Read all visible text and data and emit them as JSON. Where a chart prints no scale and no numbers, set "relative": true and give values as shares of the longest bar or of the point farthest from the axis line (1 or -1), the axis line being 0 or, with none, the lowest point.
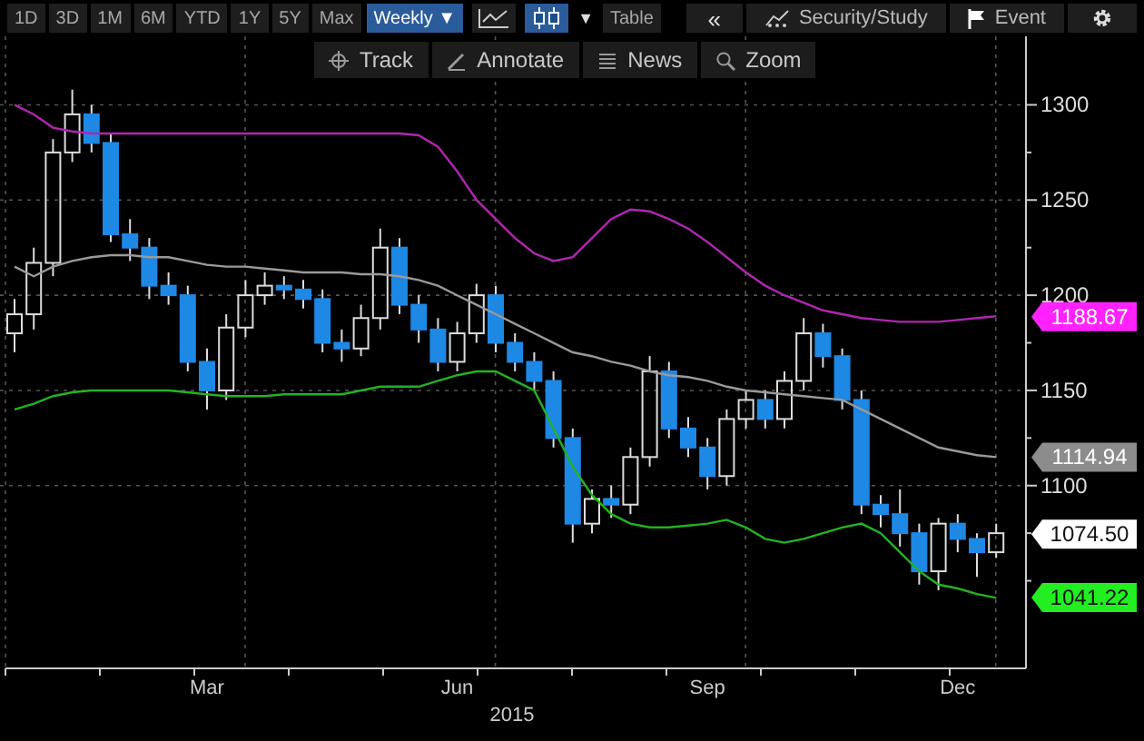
{
  "toolbar": {
    "range_buttons": [
      {
        "label": "1D",
        "selected": false
      },
      {
        "label": "3D",
        "selected": false
      },
      {
        "label": "1M",
        "selected": false
      },
      {
        "label": "6M",
        "selected": false
      },
      {
        "label": "YTD",
        "selected": false
      },
      {
        "label": "1Y",
        "selected": false
      },
      {
        "label": "5Y",
        "selected": false
      },
      {
        "label": "Max",
        "selected": false
      }
    ],
    "period_dropdown": {
      "label": "Weekly",
      "caret": "▼"
    },
    "chart_type_buttons": [
      {
        "kind": "line",
        "selected": false
      },
      {
        "kind": "candle",
        "selected": true
      }
    ],
    "chart_type_caret": "▼",
    "table_button": "Table",
    "collapse_button": "«",
    "security_study_button": "Security/Study",
    "event_button": "Event"
  },
  "chart_tools": [
    {
      "kind": "track",
      "label": "Track"
    },
    {
      "kind": "annotate",
      "label": "Annotate"
    },
    {
      "kind": "news",
      "label": "News"
    },
    {
      "kind": "zoom",
      "label": "Zoom"
    }
  ],
  "price_tags": [
    {
      "label": "1188.67",
      "color": "#ff22ff"
    },
    {
      "label": "1114.94",
      "color": "#8c8c8c"
    },
    {
      "label": "1074.50",
      "color": "#ffffff"
    },
    {
      "label": "1041.22",
      "color": "#22ee22"
    }
  ],
  "price_chart": {
    "chart_data": {
      "type": "candlestick",
      "categories": [
        null,
        null,
        null,
        null,
        null,
        null,
        null,
        null,
        null,
        null,
        "Mar",
        null,
        null,
        null,
        null,
        null,
        null,
        null,
        null,
        null,
        null,
        null,
        null,
        "Jun",
        null,
        null,
        null,
        null,
        null,
        null,
        null,
        null,
        null,
        null,
        null,
        null,
        "Sep",
        null,
        null,
        null,
        null,
        null,
        null,
        null,
        null,
        null,
        null,
        null,
        null,
        "Dec",
        null,
        null
      ],
      "xlabel": "2015",
      "grid": true,
      "ylim": [
        1004,
        1336
      ],
      "yticks": [
        1100,
        1150,
        1200,
        1250,
        1300
      ],
      "ohlc": [
        [
          1180,
          1198,
          1170,
          1190
        ],
        [
          1190,
          1225,
          1182,
          1217
        ],
        [
          1217,
          1282,
          1210,
          1275
        ],
        [
          1275,
          1308,
          1270,
          1295
        ],
        [
          1295,
          1300,
          1275,
          1280
        ],
        [
          1280,
          1285,
          1228,
          1232
        ],
        [
          1232,
          1240,
          1218,
          1225
        ],
        [
          1225,
          1230,
          1198,
          1205
        ],
        [
          1205,
          1212,
          1195,
          1200
        ],
        [
          1200,
          1205,
          1160,
          1165
        ],
        [
          1165,
          1172,
          1140,
          1150
        ],
        [
          1150,
          1190,
          1145,
          1183
        ],
        [
          1183,
          1208,
          1178,
          1200
        ],
        [
          1200,
          1212,
          1195,
          1205
        ],
        [
          1205,
          1210,
          1198,
          1203
        ],
        [
          1203,
          1208,
          1193,
          1198
        ],
        [
          1198,
          1203,
          1170,
          1175
        ],
        [
          1175,
          1182,
          1165,
          1172
        ],
        [
          1172,
          1195,
          1168,
          1188
        ],
        [
          1188,
          1235,
          1182,
          1225
        ],
        [
          1225,
          1230,
          1190,
          1195
        ],
        [
          1195,
          1200,
          1175,
          1182
        ],
        [
          1182,
          1188,
          1160,
          1165
        ],
        [
          1165,
          1186,
          1160,
          1180
        ],
        [
          1180,
          1206,
          1175,
          1200
        ],
        [
          1200,
          1205,
          1170,
          1175
        ],
        [
          1175,
          1180,
          1160,
          1165
        ],
        [
          1165,
          1170,
          1150,
          1155
        ],
        [
          1155,
          1160,
          1120,
          1125
        ],
        [
          1125,
          1130,
          1070,
          1080
        ],
        [
          1080,
          1098,
          1075,
          1093
        ],
        [
          1093,
          1100,
          1083,
          1090
        ],
        [
          1090,
          1120,
          1085,
          1115
        ],
        [
          1115,
          1168,
          1110,
          1160
        ],
        [
          1160,
          1165,
          1125,
          1130
        ],
        [
          1130,
          1136,
          1115,
          1120
        ],
        [
          1120,
          1125,
          1098,
          1105
        ],
        [
          1105,
          1140,
          1100,
          1135
        ],
        [
          1135,
          1150,
          1130,
          1145
        ],
        [
          1145,
          1150,
          1130,
          1135
        ],
        [
          1135,
          1160,
          1130,
          1155
        ],
        [
          1155,
          1188,
          1150,
          1180
        ],
        [
          1180,
          1185,
          1162,
          1168
        ],
        [
          1168,
          1172,
          1140,
          1145
        ],
        [
          1145,
          1150,
          1085,
          1090
        ],
        [
          1090,
          1095,
          1078,
          1085
        ],
        [
          1085,
          1098,
          1068,
          1075
        ],
        [
          1075,
          1080,
          1048,
          1055
        ],
        [
          1055,
          1083,
          1045,
          1080
        ],
        [
          1080,
          1085,
          1065,
          1072
        ],
        [
          1072,
          1075,
          1052,
          1065
        ],
        [
          1065,
          1080,
          1062,
          1075
        ]
      ]
    }
  },
  "bands_chart": {
    "chart_data": {
      "type": "line",
      "relative": true,
      "ylim": [
        1004,
        1336
      ],
      "series": [
        {
          "color": "#b026b0",
          "values": [
            1300,
            1295,
            1288,
            1286,
            1285,
            1285,
            1285,
            1285,
            1285,
            1285,
            1285,
            1285,
            1285,
            1285,
            1285,
            1285,
            1285,
            1285,
            1285,
            1285,
            1285,
            1284,
            1278,
            1265,
            1250,
            1240,
            1230,
            1222,
            1218,
            1220,
            1230,
            1240,
            1245,
            1244,
            1240,
            1235,
            1228,
            1220,
            1212,
            1205,
            1200,
            1196,
            1192,
            1190,
            1188,
            1187,
            1186,
            1186,
            1186,
            1187,
            1188,
            1189
          ]
        },
        {
          "color": "#9a9a9a",
          "values": [
            1215,
            1210,
            1215,
            1218,
            1220,
            1221,
            1221,
            1220,
            1220,
            1218,
            1216,
            1215,
            1215,
            1214,
            1213,
            1212,
            1212,
            1212,
            1211,
            1211,
            1210,
            1208,
            1205,
            1200,
            1195,
            1190,
            1185,
            1180,
            1175,
            1170,
            1168,
            1165,
            1163,
            1160,
            1158,
            1157,
            1155,
            1152,
            1150,
            1149,
            1148,
            1147,
            1146,
            1145,
            1140,
            1135,
            1130,
            1125,
            1120,
            1118,
            1116,
            1115
          ]
        },
        {
          "color": "#22b322",
          "values": [
            1140,
            1143,
            1147,
            1149,
            1150,
            1150,
            1150,
            1150,
            1150,
            1149,
            1148,
            1147,
            1147,
            1147,
            1148,
            1148,
            1148,
            1148,
            1150,
            1152,
            1152,
            1152,
            1155,
            1158,
            1160,
            1160,
            1155,
            1150,
            1130,
            1110,
            1095,
            1085,
            1080,
            1078,
            1078,
            1079,
            1080,
            1082,
            1078,
            1072,
            1070,
            1072,
            1075,
            1078,
            1080,
            1075,
            1065,
            1055,
            1048,
            1046,
            1043,
            1041
          ]
        }
      ]
    }
  }
}
